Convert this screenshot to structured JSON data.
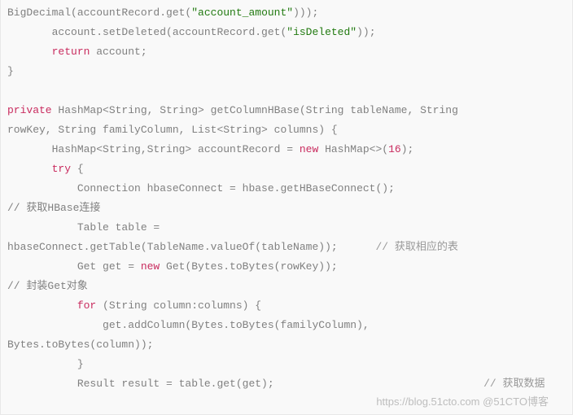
{
  "code": {
    "l1a": "BigDecimal(accountRecord.get(",
    "l1s": "\"account_amount\"",
    "l1b": ")));",
    "l2a": "       account.setDeleted(accountRecord.get(",
    "l2s": "\"isDeleted\"",
    "l2b": "));",
    "l3k": "       return",
    "l3a": " account;",
    "l4": "}",
    "l5": "",
    "l6a": "private",
    "l6b": " HashMap<String, String> getColumnHBase(String tableName, String ",
    "l7": "rowKey, String familyColumn, List<String> columns) {",
    "l8a": "       HashMap<String,String> accountRecord = ",
    "l8k": "new",
    "l8b": " HashMap<>(",
    "l8n": "16",
    "l8c": ");",
    "l9k": "       try",
    "l9a": " {",
    "l10": "           Connection hbaseConnect = hbase.getHBaseConnect();                ",
    "l11": "// 获取HBase连接",
    "l12": "           Table table = ",
    "l13a": "hbaseConnect.getTable(TableName.valueOf(tableName));      ",
    "l13c": "// 获取相应的表",
    "l14a": "           Get get = ",
    "l14k": "new",
    "l14b": " Get(Bytes.toBytes(rowKey));                          ",
    "l15": "// 封装Get对象",
    "l16k": "           for",
    "l16a": " (String column:columns) {",
    "l17": "               get.addColumn(Bytes.toBytes(familyColumn), ",
    "l18": "Bytes.toBytes(column));",
    "l19": "           }",
    "l20a": "           Result result = table.get(get);                                 ",
    "l20c": "// 获取数据"
  },
  "watermark": "https://blog.51cto.com @51CTO博客"
}
